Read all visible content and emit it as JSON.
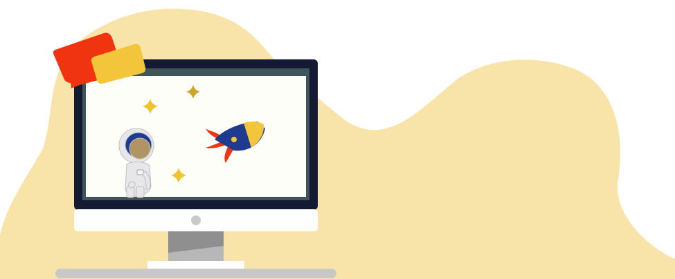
{
  "colors": {
    "background": "#ffffff",
    "blob": "#f8e4a8",
    "monitor_frame": "#141a33",
    "monitor_bezel": "#fefefe",
    "screen_border": "#3f5658",
    "screen_fill": "#fefef9",
    "stand": "#b7b7b7",
    "stand_shadow": "#8f8f8f",
    "base": "#c8c8c8",
    "camera": "#c9c9c9",
    "chat_red": "#f0340f",
    "chat_yellow": "#f3c53a",
    "star_yellow": "#efc22e",
    "star_gold": "#c9a530",
    "rocket_body": "#1f3b8f",
    "rocket_nose": "#f3c53a",
    "rocket_flame": "#f0340f",
    "astronaut_suit": "#e7e7ea",
    "astronaut_visor": "#1f3b8f",
    "astronaut_face": "#b09463"
  },
  "icons": {
    "chat": "chat-bubbles-icon",
    "rocket": "rocket-icon",
    "astronaut": "astronaut-icon",
    "star": "sparkle-star-icon"
  }
}
